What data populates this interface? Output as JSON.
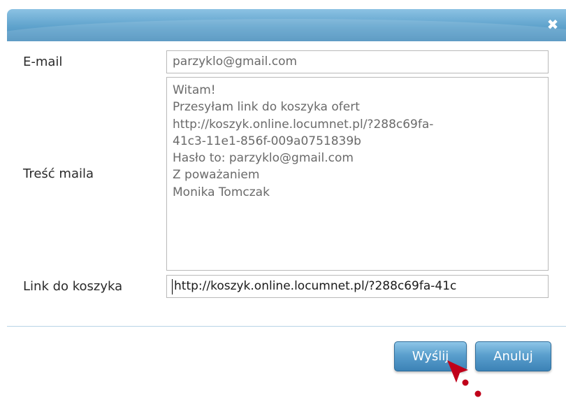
{
  "dialog": {
    "close_label": "✖",
    "email": {
      "label": "E-mail",
      "value": "parzyklo@gmail.com"
    },
    "message": {
      "label": "Treść maila",
      "lines": [
        "Witam!",
        "Przesyłam link do koszyka ofert",
        "http://koszyk.online.locumnet.pl/?288c69fa-",
        "41c3-11e1-856f-009a0751839b",
        "Hasło to: parzyklo@gmail.com",
        "Z poważaniem",
        "Monika Tomczak"
      ]
    },
    "link": {
      "label": "Link do koszyka",
      "value": "http://koszyk.online.locumnet.pl/?288c69fa-41c"
    },
    "buttons": {
      "send": "Wyślij",
      "cancel": "Anuluj"
    }
  },
  "colors": {
    "titlebar": "#5ea2cc",
    "button": "#4a8fc2",
    "cursor": "#c0001a"
  }
}
